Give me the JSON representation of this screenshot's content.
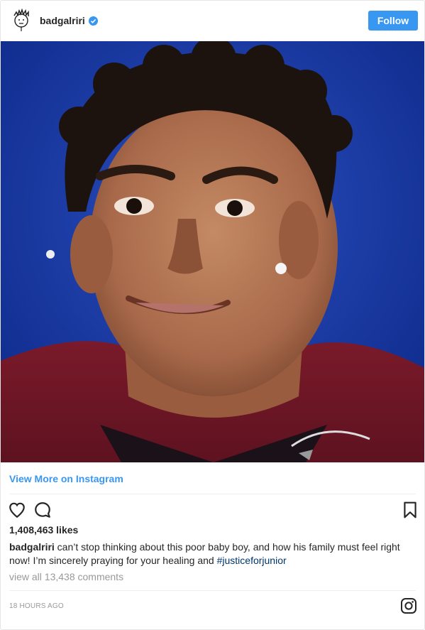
{
  "header": {
    "username": "badgalriri",
    "follow_label": "Follow",
    "verified": true
  },
  "post": {
    "view_more_label": "View More on Instagram",
    "likes": "1,408,463 likes",
    "caption_user": "badgalriri",
    "caption_text": " can’t stop thinking about this poor baby boy, and how his family must feel right now! I’m sincerely praying for your healing and ",
    "hashtag": "#justiceforjunior",
    "comments_link": "view all 13,438 comments",
    "timestamp": "18 HOURS AGO"
  },
  "icons": {
    "like": "heart-icon",
    "comment": "comment-icon",
    "save": "bookmark-icon",
    "brand": "instagram-icon",
    "verified": "verified-badge-icon"
  },
  "colors": {
    "accent": "#3897f0",
    "hashtag": "#003569",
    "muted": "#999999",
    "text": "#262626"
  }
}
